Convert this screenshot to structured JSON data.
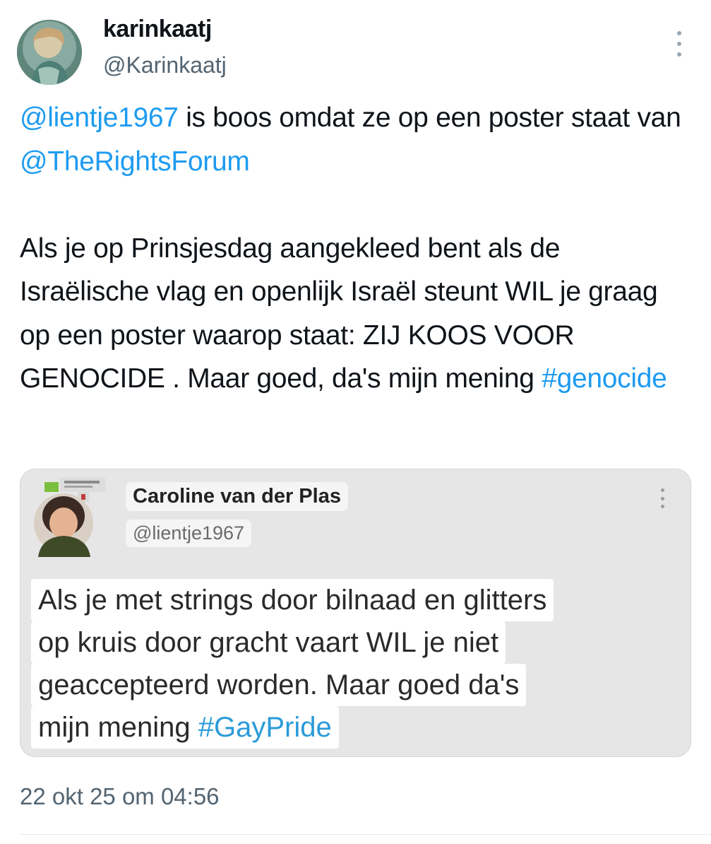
{
  "author": {
    "display_name": "karinkaatj",
    "handle": "@Karinkaatj",
    "avatar_icon": "avatar-painting-icon"
  },
  "tweet": {
    "paragraph1": {
      "mention1": "@lientje1967",
      "text1": " is boos omdat ze op een poster staat van ",
      "mention2": "@TheRightsForum"
    },
    "paragraph2": {
      "text": "Als je op Prinsjesdag aangekleed bent als de Israëlische vlag en openlijk Israël steunt WIL je graag op een poster waarop staat: ZIJ KOOS VOOR GENOCIDE . Maar goed, da's mijn mening ",
      "hashtag": "#genocide"
    }
  },
  "embedded": {
    "name": "Caroline van der Plas",
    "handle": "@lientje1967",
    "lines": [
      "Als je met strings door bilnaad en glitters",
      "op kruis door gracht vaart WIL je niet",
      "geaccepteerd worden. Maar goed da's",
      "mijn mening "
    ],
    "hashtag": "#GayPride"
  },
  "timestamp": "22 okt 25 om 04:56",
  "colors": {
    "link": "#1d9bf0",
    "secondary_text": "#536471",
    "inner_hashtag": "#2a9bd8"
  }
}
